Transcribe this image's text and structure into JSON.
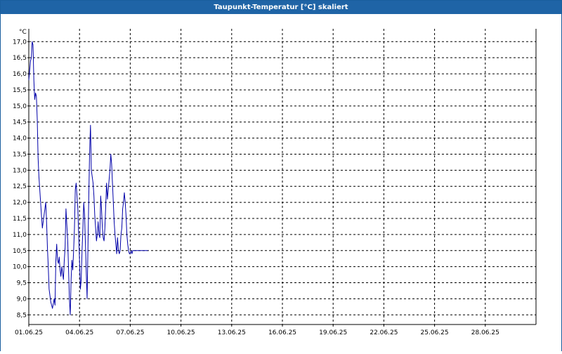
{
  "window": {
    "title": "Taupunkt-Temperatur [°C] skaliert"
  },
  "colors": {
    "title_bar": "#1f64a6",
    "series": "#0000a8",
    "grid": "#000000"
  },
  "chart_data": {
    "type": "line",
    "title": "Taupunkt-Temperatur [°C] skaliert",
    "ylabel": "°C",
    "xlabel": "",
    "ylim": [
      8.2,
      17.4
    ],
    "xlim": [
      0,
      30
    ],
    "grid": true,
    "y_ticks": [
      "8,5",
      "9,0",
      "9,5",
      "10,0",
      "10,5",
      "11,0",
      "11,5",
      "12,0",
      "12,5",
      "13,0",
      "13,5",
      "14,0",
      "14,5",
      "15,0",
      "15,5",
      "16,0",
      "16,5",
      "17,0"
    ],
    "x_ticks": [
      "01.06.25",
      "04.06.25",
      "07.06.25",
      "10.06.25",
      "13.06.25",
      "16.06.25",
      "19.06.25",
      "22.06.25",
      "25.06.25",
      "28.06.25"
    ],
    "series": [
      {
        "x": [
          0,
          0.05,
          0.1,
          0.15,
          0.2,
          0.25,
          0.3,
          0.35,
          0.4,
          0.45,
          0.5,
          0.55,
          0.6,
          0.65,
          0.7,
          0.75,
          0.8,
          0.85,
          0.9,
          0.95,
          1.0,
          1.05,
          1.1,
          1.15,
          1.2,
          1.3,
          1.4,
          1.5,
          1.55,
          1.6,
          1.65,
          1.7,
          1.75,
          1.8,
          1.85,
          1.9,
          1.95,
          2.0,
          2.05,
          2.1,
          2.15,
          2.2,
          2.3,
          2.4,
          2.45,
          2.5,
          2.55,
          2.6,
          2.65,
          2.7,
          2.75,
          2.8,
          2.9,
          3.0,
          3.05,
          3.1,
          3.15,
          3.2,
          3.25,
          3.3,
          3.4,
          3.45,
          3.5,
          3.55,
          3.6,
          3.65,
          3.7,
          3.8,
          3.85,
          3.9,
          3.95,
          4.0,
          4.05,
          4.1,
          4.15,
          4.2,
          4.25,
          4.3,
          4.35,
          4.4,
          4.45,
          4.5,
          4.55,
          4.6,
          4.65,
          4.7,
          4.8,
          4.85,
          4.9,
          4.95,
          5.0,
          5.05,
          5.1,
          5.15,
          5.2,
          5.25,
          5.3,
          5.35,
          5.4,
          5.45,
          5.5,
          5.55,
          5.6,
          5.65,
          5.7,
          5.75,
          5.8,
          5.85,
          5.9,
          5.95,
          6.0,
          6.05,
          6.1,
          6.15,
          6.2,
          6.25,
          6.3,
          6.35,
          6.4,
          6.45,
          6.5,
          6.55,
          6.6,
          6.65,
          6.7,
          6.75,
          6.8,
          6.85,
          6.9,
          6.95,
          7.0,
          7.05
        ],
        "values": [
          15.8,
          16.1,
          16.4,
          16.5,
          17.0,
          16.9,
          15.8,
          15.2,
          15.4,
          15.3,
          14.6,
          13.4,
          12.8,
          12.4,
          12.0,
          11.6,
          11.2,
          11.4,
          11.6,
          11.8,
          12.0,
          11.4,
          10.6,
          10.0,
          9.3,
          8.9,
          8.7,
          9.0,
          8.8,
          10.2,
          10.7,
          10.2,
          10.1,
          10.3,
          9.9,
          9.7,
          10.0,
          9.8,
          9.6,
          10.2,
          10.6,
          11.8,
          10.8,
          9.0,
          8.5,
          9.6,
          10.2,
          9.9,
          10.5,
          11.2,
          12.4,
          12.6,
          11.8,
          10.2,
          9.3,
          9.6,
          10.5,
          11.2,
          12.0,
          11.6,
          9.8,
          9.0,
          10.6,
          12.2,
          13.6,
          14.4,
          13.0,
          12.6,
          12.2,
          11.6,
          11.2,
          10.8,
          11.0,
          11.4,
          11.0,
          10.9,
          12.2,
          11.8,
          11.2,
          10.9,
          10.8,
          11.2,
          11.9,
          12.6,
          12.1,
          12.4,
          13.0,
          13.5,
          13.2,
          12.6,
          12.0,
          11.4,
          11.0,
          10.7,
          10.4,
          10.9,
          10.5,
          10.4,
          10.5,
          11.0,
          11.2,
          11.8,
          12.0,
          12.3,
          12.0,
          11.6,
          11.0,
          10.7,
          10.5,
          10.4,
          10.4,
          10.5,
          10.4,
          10.5,
          10.5,
          10.5,
          10.5,
          10.5,
          10.5,
          10.5,
          10.5,
          10.5,
          10.5,
          10.5,
          10.5,
          10.5,
          10.5,
          10.5,
          10.5,
          10.5,
          10.5,
          10.5
        ]
      }
    ]
  }
}
